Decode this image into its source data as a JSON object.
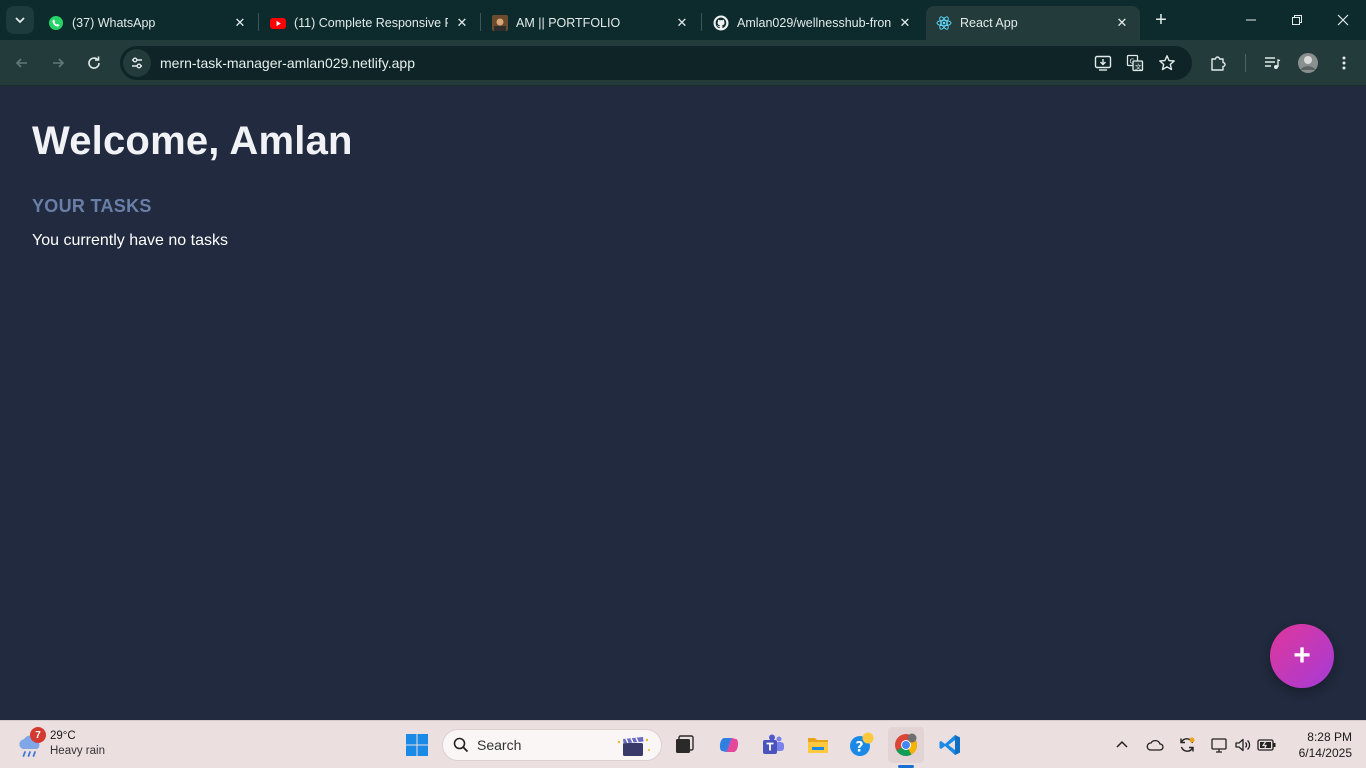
{
  "browser": {
    "tabs": [
      {
        "title": "(37) WhatsApp",
        "icon": "whatsapp-icon"
      },
      {
        "title": "(11) Complete Responsive Pc",
        "icon": "youtube-icon"
      },
      {
        "title": "AM || PORTFOLIO",
        "icon": "portfolio-icon"
      },
      {
        "title": "Amlan029/wellnesshub-fron",
        "icon": "github-icon"
      },
      {
        "title": "React App",
        "icon": "react-icon",
        "active": true
      }
    ],
    "url": "mern-task-manager-amlan029.netlify.app"
  },
  "page": {
    "welcome": "Welcome, Amlan",
    "tasks_heading": "YOUR TASKS",
    "empty_message": "You currently have no tasks",
    "fab_label": "+"
  },
  "taskbar": {
    "weather": {
      "badge": "7",
      "temperature": "29°C",
      "condition": "Heavy rain"
    },
    "search_label": "Search",
    "clock": {
      "time": "8:28 PM",
      "date": "6/14/2025"
    }
  },
  "colors": {
    "page_bg": "#212a3e",
    "heading_muted": "#6a7fa8",
    "fab_gradient_start": "#e0389a",
    "fab_gradient_end": "#a53ad8",
    "chrome_bg": "#0d2b2d"
  }
}
